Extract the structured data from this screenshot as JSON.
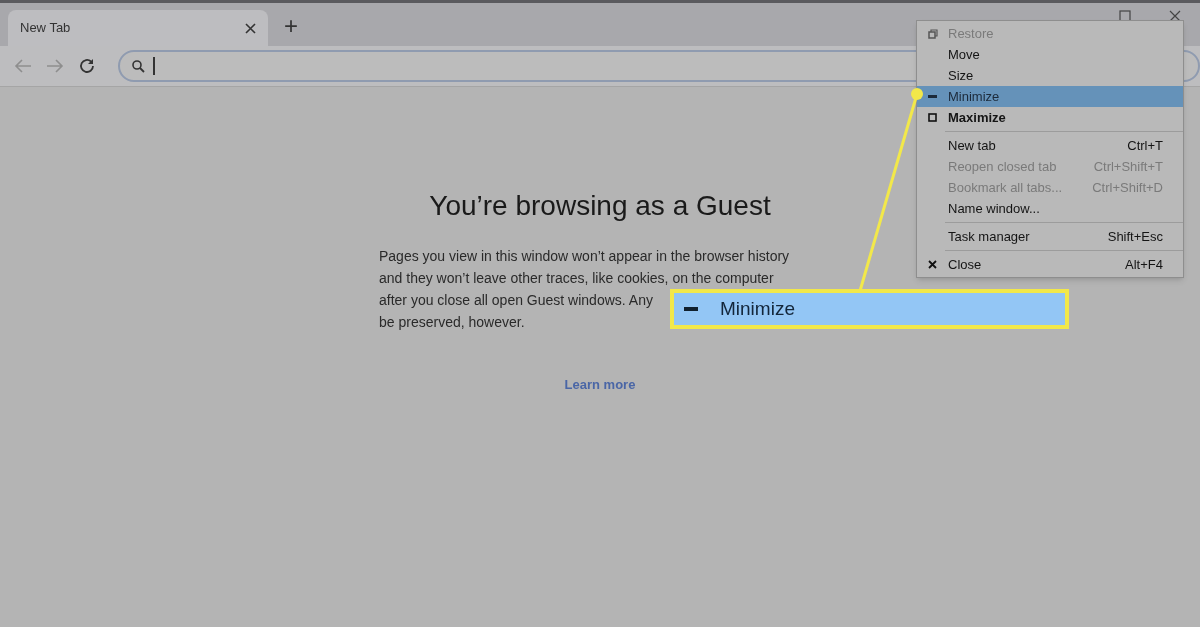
{
  "tabs": [
    {
      "title": "New Tab",
      "selected": true
    }
  ],
  "new_tab_button": "+",
  "page": {
    "heading": "You’re browsing as a Guest",
    "paragraph_lines": [
      "Pages you view in this window won’t appear in the browser history",
      "and they won’t leave other traces, like cookies, on the computer",
      "after you close all open Guest windows. Any",
      "be preserved, however."
    ],
    "link": "Learn more"
  },
  "system_menu": [
    {
      "kind": "item",
      "label": "Restore",
      "disabled": true,
      "selected": false,
      "bold": false
    },
    {
      "kind": "item",
      "label": "Move",
      "disabled": false,
      "selected": false,
      "bold": false
    },
    {
      "kind": "item",
      "label": "Size",
      "disabled": false,
      "selected": false,
      "bold": false
    },
    {
      "kind": "item",
      "label": "Minimize",
      "disabled": false,
      "selected": true,
      "bold": false
    },
    {
      "kind": "item",
      "label": "Maximize",
      "disabled": false,
      "selected": false,
      "bold": true
    },
    {
      "kind": "separator"
    },
    {
      "kind": "item",
      "label": "New tab",
      "shortcut": "Ctrl+T",
      "disabled": false,
      "selected": false,
      "bold": false
    },
    {
      "kind": "item",
      "label": "Reopen closed tab",
      "shortcut": "Ctrl+Shift+T",
      "disabled": true,
      "selected": false,
      "bold": false
    },
    {
      "kind": "item",
      "label": "Bookmark all tabs...",
      "shortcut": "Ctrl+Shift+D",
      "disabled": true,
      "selected": false,
      "bold": false
    },
    {
      "kind": "item",
      "label": "Name window...",
      "disabled": false,
      "selected": false,
      "bold": false
    },
    {
      "kind": "separator"
    },
    {
      "kind": "item",
      "label": "Task manager",
      "shortcut": "Shift+Esc",
      "disabled": false,
      "selected": false,
      "bold": false
    },
    {
      "kind": "separator"
    },
    {
      "kind": "item",
      "label": "Close",
      "shortcut": "Alt+F4",
      "disabled": false,
      "selected": false,
      "bold": false
    }
  ],
  "callout": {
    "label": "Minimize"
  }
}
